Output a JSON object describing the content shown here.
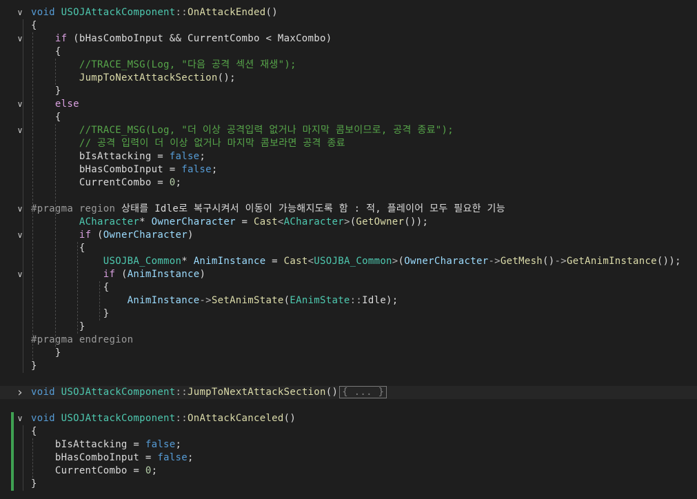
{
  "editor": {
    "lines": [
      [
        [
          "kw",
          "void "
        ],
        [
          "ty",
          "USOJAttackComponent"
        ],
        [
          "op",
          "::"
        ],
        [
          "fn",
          "OnAttackEnded"
        ],
        [
          "pl",
          "()"
        ]
      ],
      [
        [
          "pl",
          "{"
        ]
      ],
      [
        [
          "pl",
          "    "
        ],
        [
          "ctl",
          "if"
        ],
        [
          "pl",
          " (bHasComboInput && CurrentCombo < MaxCombo)"
        ]
      ],
      [
        [
          "pl",
          "    {"
        ]
      ],
      [
        [
          "pl",
          "        "
        ],
        [
          "cm",
          "//TRACE_MSG(Log, \"다음 공격 섹션 재생\");"
        ]
      ],
      [
        [
          "pl",
          "        "
        ],
        [
          "fn",
          "JumpToNextAttackSection"
        ],
        [
          "pl",
          "();"
        ]
      ],
      [
        [
          "pl",
          "    }"
        ]
      ],
      [
        [
          "pl",
          "    "
        ],
        [
          "ctl",
          "else"
        ]
      ],
      [
        [
          "pl",
          "    {"
        ]
      ],
      [
        [
          "pl",
          "        "
        ],
        [
          "cm",
          "//TRACE_MSG(Log, \"더 이상 공격입력 없거나 마지막 콤보이므로, 공격 종료\");"
        ]
      ],
      [
        [
          "pl",
          "        "
        ],
        [
          "cm",
          "// 공격 입력이 더 이상 없거나 마지막 콤보라면 공격 종료"
        ]
      ],
      [
        [
          "pl",
          "        bIsAttacking = "
        ],
        [
          "kw",
          "false"
        ],
        [
          "pl",
          ";"
        ]
      ],
      [
        [
          "pl",
          "        bHasComboInput = "
        ],
        [
          "kw",
          "false"
        ],
        [
          "pl",
          ";"
        ]
      ],
      [
        [
          "pl",
          "        CurrentCombo = "
        ],
        [
          "num",
          "0"
        ],
        [
          "pl",
          ";"
        ]
      ],
      [],
      [
        [
          "pre",
          "#pragma region "
        ],
        [
          "pl",
          "상태를 Idle로 복구시켜서 이동이 가능해지도록 함 : 적, 플레이어 모두 필요한 기능"
        ]
      ],
      [
        [
          "pl",
          "        "
        ],
        [
          "ty",
          "ACharacter"
        ],
        [
          "pl",
          "* "
        ],
        [
          "var",
          "OwnerCharacter"
        ],
        [
          "pl",
          " = "
        ],
        [
          "fn",
          "Cast"
        ],
        [
          "op",
          "<"
        ],
        [
          "ty",
          "ACharacter"
        ],
        [
          "op",
          ">"
        ],
        [
          "pl",
          "("
        ],
        [
          "fn",
          "GetOwner"
        ],
        [
          "pl",
          "());"
        ]
      ],
      [
        [
          "pl",
          "        "
        ],
        [
          "ctl",
          "if"
        ],
        [
          "pl",
          " ("
        ],
        [
          "var",
          "OwnerCharacter"
        ],
        [
          "pl",
          ")"
        ]
      ],
      [
        [
          "pl",
          "        {"
        ]
      ],
      [
        [
          "pl",
          "            "
        ],
        [
          "ty",
          "USOJBA_Common"
        ],
        [
          "pl",
          "* "
        ],
        [
          "var",
          "AnimInstance"
        ],
        [
          "pl",
          " = "
        ],
        [
          "fn",
          "Cast"
        ],
        [
          "op",
          "<"
        ],
        [
          "ty",
          "USOJBA_Common"
        ],
        [
          "op",
          ">"
        ],
        [
          "pl",
          "("
        ],
        [
          "var",
          "OwnerCharacter"
        ],
        [
          "op",
          "->"
        ],
        [
          "fn",
          "GetMesh"
        ],
        [
          "pl",
          "()"
        ],
        [
          "op",
          "->"
        ],
        [
          "fn",
          "GetAnimInstance"
        ],
        [
          "pl",
          "());"
        ]
      ],
      [
        [
          "pl",
          "            "
        ],
        [
          "ctl",
          "if"
        ],
        [
          "pl",
          " ("
        ],
        [
          "var",
          "AnimInstance"
        ],
        [
          "pl",
          ")"
        ]
      ],
      [
        [
          "pl",
          "            {"
        ]
      ],
      [
        [
          "pl",
          "                "
        ],
        [
          "var",
          "AnimInstance"
        ],
        [
          "op",
          "->"
        ],
        [
          "fn",
          "SetAnimState"
        ],
        [
          "pl",
          "("
        ],
        [
          "ty",
          "EAnimState"
        ],
        [
          "op",
          "::"
        ],
        [
          "pl",
          "Idle);"
        ]
      ],
      [
        [
          "pl",
          "            }"
        ]
      ],
      [
        [
          "pl",
          "        }"
        ]
      ],
      [
        [
          "pre",
          "#pragma endregion"
        ]
      ],
      [
        [
          "pl",
          "    }"
        ]
      ],
      [
        [
          "pl",
          "}"
        ]
      ],
      [],
      [
        [
          "kw",
          "void "
        ],
        [
          "ty",
          "USOJAttackComponent"
        ],
        [
          "op",
          "::"
        ],
        [
          "fn",
          "JumpToNextAttackSection"
        ],
        [
          "pl",
          "()"
        ],
        [
          "box",
          "{ ... }"
        ]
      ],
      [],
      [
        [
          "kw",
          "void "
        ],
        [
          "ty",
          "USOJAttackComponent"
        ],
        [
          "op",
          "::"
        ],
        [
          "fn",
          "OnAttackCanceled"
        ],
        [
          "pl",
          "()"
        ]
      ],
      [
        [
          "pl",
          "{"
        ]
      ],
      [
        [
          "pl",
          "    bIsAttacking = "
        ],
        [
          "kw",
          "false"
        ],
        [
          "pl",
          ";"
        ]
      ],
      [
        [
          "pl",
          "    bHasComboInput = "
        ],
        [
          "kw",
          "false"
        ],
        [
          "pl",
          ";"
        ]
      ],
      [
        [
          "pl",
          "    CurrentCombo = "
        ],
        [
          "num",
          "0"
        ],
        [
          "pl",
          ";"
        ]
      ],
      [
        [
          "pl",
          "}"
        ]
      ]
    ],
    "fold_markers": {
      "0": "expanded",
      "2": "expanded",
      "7": "expanded",
      "9": "expanded",
      "15": "expanded",
      "17": "expanded",
      "20": "expanded",
      "29": "collapsed",
      "31": "expanded"
    },
    "changed_lines": [
      31,
      32,
      33,
      34,
      35,
      36
    ],
    "highlighted_line": 29,
    "icons": {
      "expanded": "chevron-down-icon",
      "collapsed": "chevron-right-icon"
    },
    "colors": {
      "background": "#1e1e1e",
      "keyword": "#569cd6",
      "control": "#d8a0df",
      "type": "#4ec9b0",
      "function": "#dcdcaa",
      "comment": "#57a64a",
      "number": "#b5cea8",
      "preprocessor": "#9b9b9b",
      "variable": "#9cdcfe",
      "change_bar": "#3fa152"
    }
  }
}
